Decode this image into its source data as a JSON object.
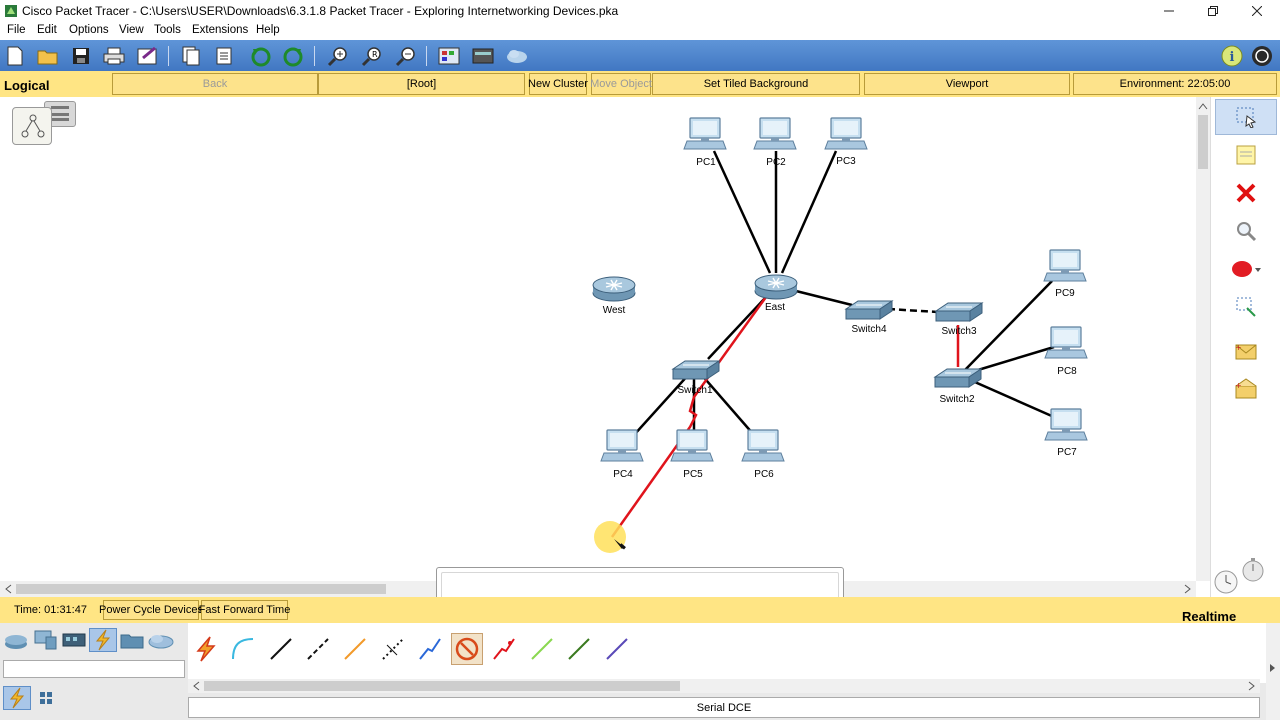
{
  "window": {
    "title": "Cisco Packet Tracer - C:\\Users\\USER\\Downloads\\6.3.1.8 Packet Tracer - Exploring Internetworking Devices.pka"
  },
  "menu": [
    "File",
    "Edit",
    "Options",
    "View",
    "Tools",
    "Extensions",
    "Help"
  ],
  "workspace": {
    "mode_label": "Logical",
    "back_label": "Back",
    "root_label": "[Root]",
    "new_cluster_label": "New Cluster",
    "move_object_label": "Move Object",
    "tiled_background_label": "Set Tiled Background",
    "viewport_label": "Viewport",
    "environment_label": "Environment: 22:05:00"
  },
  "devices": {
    "pc1": "PC1",
    "pc2": "PC2",
    "pc3": "PC3",
    "east": "East",
    "west": "West",
    "switch1": "Switch1",
    "switch2": "Switch2",
    "switch3": "Switch3",
    "switch4": "Switch4",
    "pc4": "PC4",
    "pc5": "PC5",
    "pc6": "PC6",
    "pc7": "PC7",
    "pc8": "PC8",
    "pc9": "PC9"
  },
  "time": {
    "time_text": "Time: 01:31:47",
    "power_cycle_label": "Power Cycle Devices",
    "fast_forward_label": "Fast Forward Time",
    "mode": "Realtime"
  },
  "connections": {
    "selected_name": "Serial DCE"
  },
  "colors": {
    "toolbar": "#4a80c8",
    "workspace_bar": "#ffe584",
    "link_black": "#000000",
    "link_red": "#e0141c",
    "delete_red": "#e01010"
  }
}
